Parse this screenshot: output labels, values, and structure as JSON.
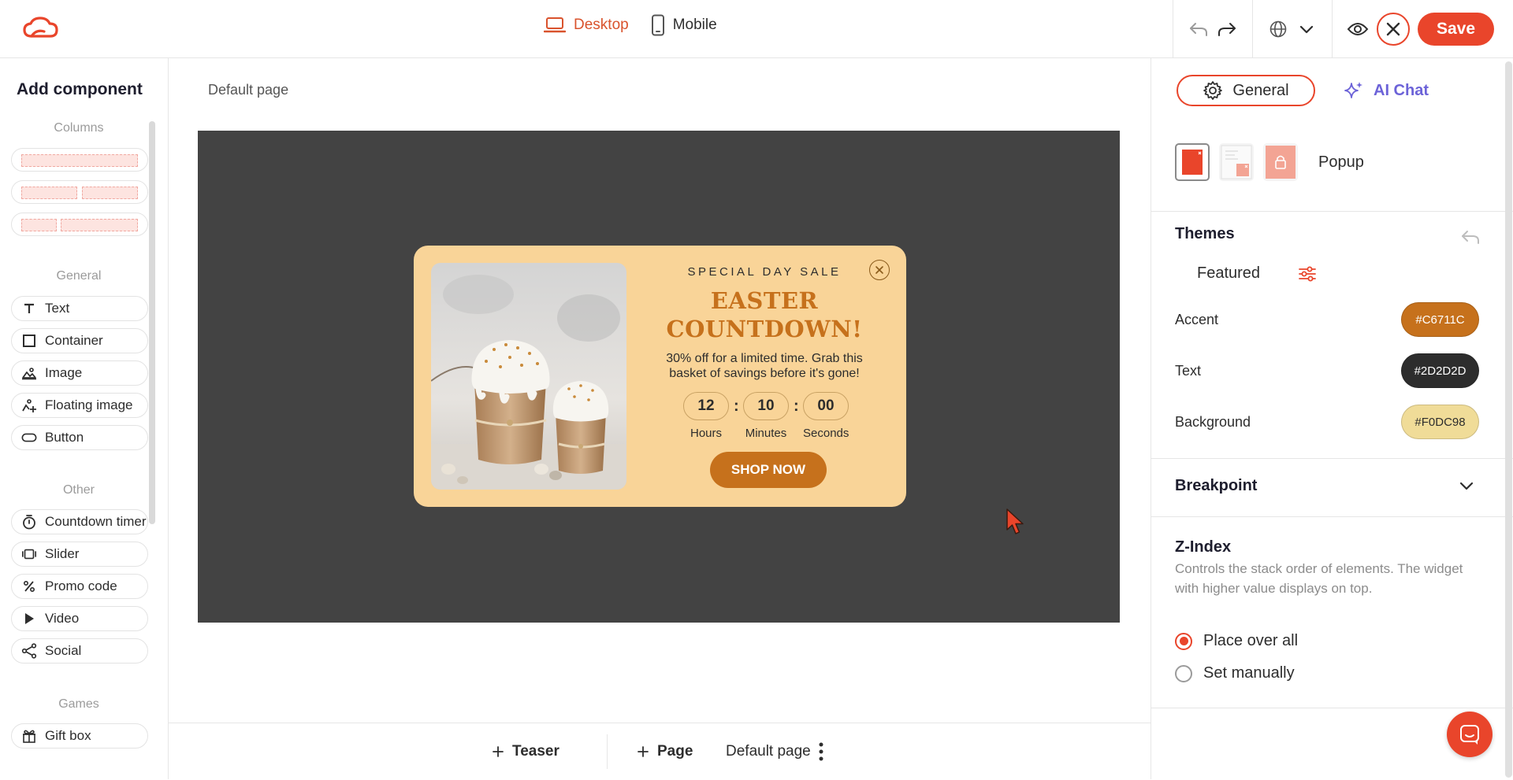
{
  "topbar": {
    "device_desktop": "Desktop",
    "device_mobile": "Mobile",
    "save_label": "Save"
  },
  "sidebar": {
    "title": "Add component",
    "sections": {
      "columns": "Columns",
      "general": "General",
      "other": "Other",
      "games": "Games"
    },
    "general_items": [
      "Text",
      "Container",
      "Image",
      "Floating image",
      "Button"
    ],
    "other_items": [
      "Countdown timer",
      "Slider",
      "Promo code",
      "Video",
      "Social"
    ],
    "games_items": [
      "Gift box"
    ]
  },
  "canvas": {
    "page_label": "Default page",
    "popup": {
      "eyebrow": "SPECIAL DAY SALE",
      "headline_line1": "EASTER",
      "headline_line2": "COUNTDOWN!",
      "description": "30% off for a limited time. Grab this basket of savings before it's gone!",
      "timer": {
        "hours": "12",
        "minutes": "10",
        "seconds": "00",
        "separator": ":",
        "hours_label": "Hours",
        "minutes_label": "Minutes",
        "seconds_label": "Seconds"
      },
      "cta": "SHOP NOW"
    }
  },
  "bottom_bar": {
    "teaser": "Teaser",
    "page": "Page",
    "current_page": "Default page"
  },
  "right_panel": {
    "tab_general": "General",
    "tab_ai": "AI Chat",
    "layout_type": "Popup",
    "themes_title": "Themes",
    "themes_filter": "Featured",
    "colors": [
      {
        "label": "Accent",
        "value": "#C6711C",
        "text_color": "#ffffff"
      },
      {
        "label": "Text",
        "value": "#2D2D2D",
        "text_color": "#ffffff"
      },
      {
        "label": "Background",
        "value": "#F0DC98",
        "text_color": "#2d2d2d"
      }
    ],
    "breakpoint_title": "Breakpoint",
    "zindex_title": "Z-Index",
    "zindex_desc": "Controls the stack order of elements. The widget with higher value displays on top.",
    "zindex_options": [
      "Place over all",
      "Set manually"
    ],
    "zindex_selected": "Place over all"
  },
  "colors": {
    "brand": "#e9452b",
    "accent": "#c6711c",
    "popup_bg": "#f9d498",
    "stage_bg": "#434343",
    "ai": "#6c63d8"
  }
}
